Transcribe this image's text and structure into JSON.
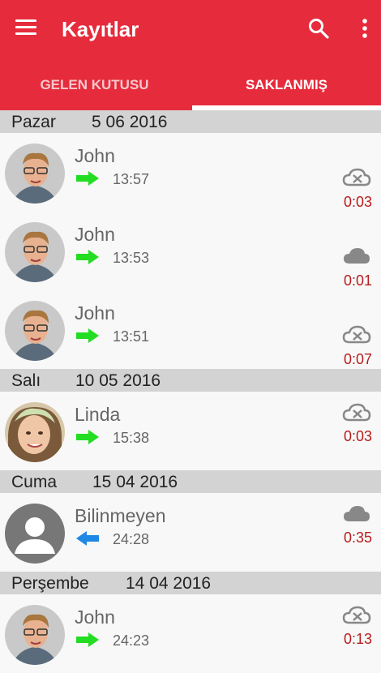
{
  "app": {
    "title": "Kayıtlar"
  },
  "tabs": [
    {
      "label": "GELEN KUTUSU"
    },
    {
      "label": "SAKLANMIŞ"
    }
  ],
  "icons": {
    "menu": "menu-icon",
    "search": "search-icon",
    "more": "more-vert-icon"
  },
  "colors": {
    "primary": "#e62b3c",
    "duration": "#b71c1c",
    "outgoing": "#22dd22",
    "incoming": "#1e88e5"
  },
  "groups": [
    {
      "day": "Pazar",
      "date": "5 06 2016",
      "entries": [
        {
          "name": "John",
          "time": "13:57",
          "duration": "0:03",
          "direction": "outgoing",
          "cloud": "cloud-off"
        },
        {
          "name": "John",
          "time": "13:53",
          "duration": "0:01",
          "direction": "outgoing",
          "cloud": "cloud"
        },
        {
          "name": "John",
          "time": "13:51",
          "duration": "0:07",
          "direction": "outgoing",
          "cloud": "cloud-off"
        }
      ]
    },
    {
      "day": "Salı",
      "date": "10 05 2016",
      "entries": [
        {
          "name": "Linda",
          "time": "15:38",
          "duration": "0:03",
          "direction": "outgoing",
          "cloud": "cloud-off"
        }
      ]
    },
    {
      "day": "Cuma",
      "date": "15 04 2016",
      "entries": [
        {
          "name": "Bilinmeyen",
          "time": "24:28",
          "duration": "0:35",
          "direction": "incoming",
          "cloud": "cloud"
        }
      ]
    },
    {
      "day": "Perşembe",
      "date": "14 04 2016",
      "entries": [
        {
          "name": "John",
          "time": "24:23",
          "duration": "0:13",
          "direction": "outgoing",
          "cloud": "cloud-off"
        }
      ]
    }
  ]
}
